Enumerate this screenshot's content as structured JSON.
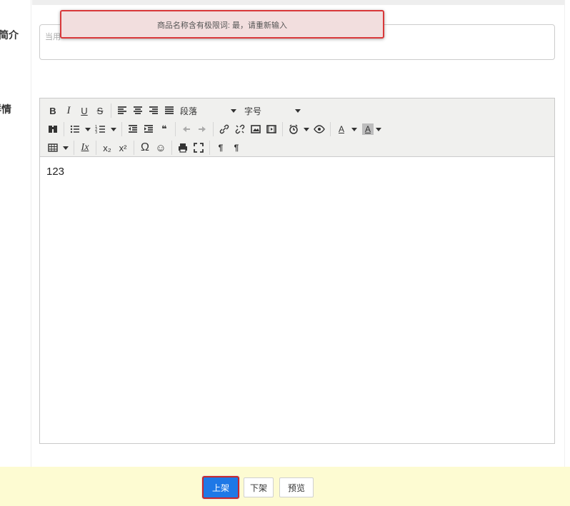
{
  "labels": {
    "intro": "简介",
    "detail": "详情"
  },
  "intro": {
    "placeholder": "当用"
  },
  "alert": {
    "message": "商品名称含有极限词: 最，请重新输入"
  },
  "editor": {
    "toolbar": {
      "paragraph_label": "段落",
      "font_size_label": "字号",
      "bold": "B",
      "italic": "I",
      "underline": "U",
      "strike": "S",
      "omega": "Ω",
      "smile": "☺",
      "subscript": "x₂",
      "superscript": "x²",
      "pilcrow": "¶",
      "pilcrow_rtl": "¶",
      "clear_format": "Ix",
      "font_color": "A",
      "bg_color": "A",
      "quote": "❝"
    },
    "content": "123"
  },
  "actions": {
    "publish": "上架",
    "unpublish": "下架",
    "preview": "预览"
  },
  "colors": {
    "primary": "#1e78e6",
    "alert_border": "#d9383a",
    "alert_bg": "#f2dede",
    "action_bar_bg": "#fdfbd2"
  }
}
